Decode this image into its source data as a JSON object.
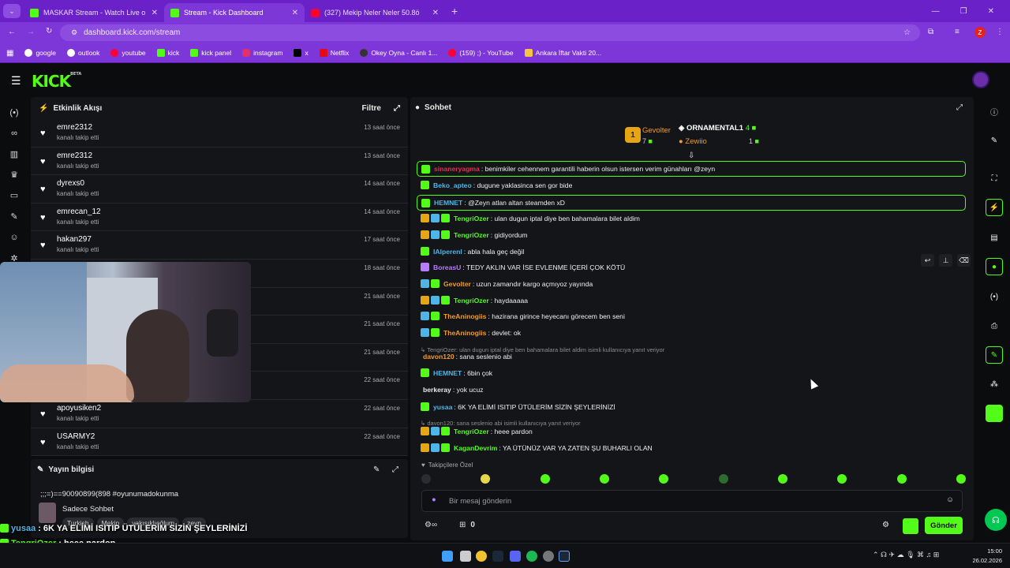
{
  "browser": {
    "tabs": [
      {
        "title": "MASKAR Stream - Watch Live o",
        "icon": "kick-favicon"
      },
      {
        "title": "Stream - Kick Dashboard",
        "icon": "kick-favicon",
        "active": true
      },
      {
        "title": "(327) Mekip Neler Neler 50.8ö",
        "icon": "youtube-favicon"
      }
    ],
    "url": "dashboard.kick.com/stream",
    "profile_letter": "Z",
    "bookmarks": [
      "google",
      "outlook",
      "youtube",
      "kick",
      "kick panel",
      "instagram",
      "x",
      "Netflix",
      "Okey Oyna - Canlı 1...",
      "(159) ;) - YouTube",
      "Ankara İftar Vakti 20..."
    ]
  },
  "kick": {
    "logo": "KICK",
    "logo_badge": "BETA"
  },
  "activity": {
    "title": "Etkinlik Akışı",
    "filter": "Filtre",
    "events": [
      {
        "user": "emre2312",
        "action": "kanalı takip etti",
        "time": "13 saat önce"
      },
      {
        "user": "emre2312",
        "action": "kanalı takip etti",
        "time": "13 saat önce"
      },
      {
        "user": "dyrexs0",
        "action": "kanalı takip etti",
        "time": "14 saat önce"
      },
      {
        "user": "emrecan_12",
        "action": "kanalı takip etti",
        "time": "14 saat önce"
      },
      {
        "user": "hakan297",
        "action": "kanalı takip etti",
        "time": "17 saat önce"
      },
      {
        "user": "",
        "action": "",
        "time": "18 saat önce"
      },
      {
        "user": "",
        "action": "",
        "time": "21 saat önce"
      },
      {
        "user": "",
        "action": "",
        "time": "21 saat önce"
      },
      {
        "user": "",
        "action": "",
        "time": "21 saat önce"
      },
      {
        "user": "",
        "action": "",
        "time": "22 saat önce"
      },
      {
        "user": "apoyusiken2",
        "action": "kanalı takip etti",
        "time": "22 saat önce"
      },
      {
        "user": "USARMY2",
        "action": "kanalı takip etti",
        "time": "22 saat önce"
      }
    ]
  },
  "stream_info": {
    "title": "Yayın bilgisi",
    "stream_title": ";;;=)==90090899(898 #oyunumadokunma",
    "category": "Sadece Sohbet",
    "tags": [
      "Turkish",
      "Mekip",
      "yakışıklıoğlum",
      "zeyn"
    ]
  },
  "chat": {
    "title": "Sohbet",
    "top_gifters": [
      {
        "rank": "1",
        "name": "Gevolter",
        "count": "7"
      },
      {
        "name": "ORNAMENTAL1",
        "count": "4"
      },
      {
        "name": "Zewiio",
        "count": "1"
      }
    ],
    "messages": [
      {
        "user": "sinaneryagma",
        "text": ": benimkiler cehennem garantili haberin olsun istersen verim günahları @zeyn",
        "color": "#e2304f",
        "highlight": true
      },
      {
        "user": "Beko_apteo",
        "text": ": dugune yaklasinca sen gor bide",
        "color": "#4fb5e8"
      },
      {
        "user": "HEMNET",
        "text": ": @Zeyn atlan altan steamden xD",
        "color": "#4fb5e8",
        "highlight": true
      },
      {
        "user": "TengriOzer",
        "text": ": ulan dugun iptal diye ben bahamalara bilet aldim",
        "color": "#53fc18"
      },
      {
        "user": "TengriOzer",
        "text": ": gidiyordum",
        "color": "#53fc18"
      },
      {
        "user": "lAlperenl",
        "text": ": abla hala geç değil",
        "color": "#4fb5e8"
      },
      {
        "user": "BoreasU",
        "text": ": TEDY AKLIN VAR İSE EVLENME İÇERİ ÇOK KÖTÜ",
        "color": "#b77cff"
      },
      {
        "user": "Gevolter",
        "text": ": uzun zamandır kargo açmıyoz yayında",
        "color": "#f59b23"
      },
      {
        "user": "TengriOzer",
        "text": ": haydaaaaa",
        "color": "#53fc18"
      },
      {
        "user": "TheAninogiis",
        "text": ": hazirana girince heyecanı görecem ben seni",
        "color": "#f59b23"
      },
      {
        "user": "TheAninogiis",
        "text": ": devlet: ok",
        "color": "#f59b23"
      },
      {
        "reply": "TengriOzer: ulan dugun iptal diye ben bahamalara bilet aldim isimli kullanıcıya yanıt veriyor"
      },
      {
        "user": "davon120",
        "text": ": sana seslenio abi",
        "color": "#f59b23"
      },
      {
        "user": "HEMNET",
        "text": ": 6bin çok",
        "color": "#4fb5e8"
      },
      {
        "user": "berkeray",
        "text": ": yok ucuz",
        "color": "#e8e8e8"
      },
      {
        "user": "yusaa",
        "text": ": 6K YA ELİMİ ISITIP ÜTÜLERİM SİZİN ŞEYLERİNİZİ",
        "color": "#4fb5e8"
      },
      {
        "reply": "davon120: sana seslenio abi isimli kullanıcıya yanıt veriyor"
      },
      {
        "user": "TengriOzer",
        "text": ": heee pardon",
        "color": "#53fc18"
      },
      {
        "user": "KaganDevrim",
        "text": ": YA ÜTÜNÜZ VAR YA ZATEN ŞU BUHARLI OLAN",
        "color": "#53fc18"
      }
    ],
    "follower_mode": "Takipçilere Özel",
    "input_placeholder": "Bir mesaj gönderin",
    "points": "0",
    "send": "Gönder"
  },
  "overlay": [
    {
      "user": "yusaa",
      "text": ": 6K YA ELİMİ ISITIP ÜTÜLERİM SİZİN ŞEYLERİNİZİ",
      "color": "#4fb5e8"
    },
    {
      "user": "TengriOzer",
      "text": ": heee pardon",
      "color": "#53fc18"
    },
    {
      "user": "KaganDevrim",
      "text": ": YA ÜTÜNÜZ VAR YA ZATEN ŞU BUHARLI OLAN",
      "color": "#53fc18"
    }
  ],
  "taskbar": {
    "time": "15:00",
    "date": "26.02.2026"
  },
  "colors": {
    "accent": "#53fc18",
    "chrome": "#7d37d8"
  }
}
